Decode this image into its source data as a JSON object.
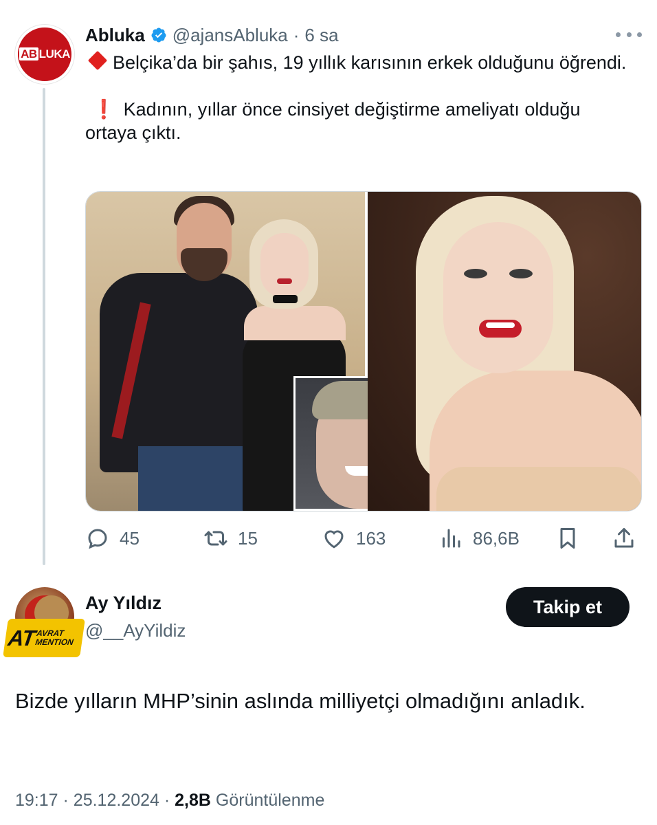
{
  "quoted_tweet": {
    "display_name": "Abluka",
    "handle": "@ajansAbluka",
    "separator": "·",
    "time": "6 sa",
    "avatar_text_a": "AB",
    "avatar_text_b": "LUKA",
    "paragraph_1": "Belçika’da bir şahıs, 19 yıllık karısının erkek olduğunu öğrendi.",
    "paragraph_2_emoji": "❗",
    "paragraph_2": "Kadının, yıllar önce cinsiyet değiştirme ameliyatı olduğu ortaya çıktı.",
    "actions": {
      "replies": "45",
      "reposts": "15",
      "likes": "163",
      "views": "86,6B"
    }
  },
  "reply_tweet": {
    "display_name": "Ay Yıldız",
    "handle": "@__AyYildiz",
    "follow_label": "Takip et",
    "avatar_badge_main": "AT",
    "avatar_badge_top": "AVRAT",
    "avatar_badge_bottom": "MENTION",
    "text": "Bizde yılların MHP’sinin aslında milliyetçi olmadığını anladık.",
    "time": "19:17",
    "date": "25.12.2024",
    "views_count": "2,8B",
    "views_label": "Görüntülenme",
    "separator": "·"
  },
  "colors": {
    "text_primary": "#0f1419",
    "text_secondary": "#536471",
    "verified_blue": "#1d9bf0",
    "brand_red": "#c4121a",
    "follow_button_bg": "#0f1419"
  },
  "icons": [
    "verified-icon",
    "more-icon",
    "reply-icon",
    "repost-icon",
    "like-icon",
    "views-icon",
    "bookmark-icon",
    "share-icon"
  ]
}
